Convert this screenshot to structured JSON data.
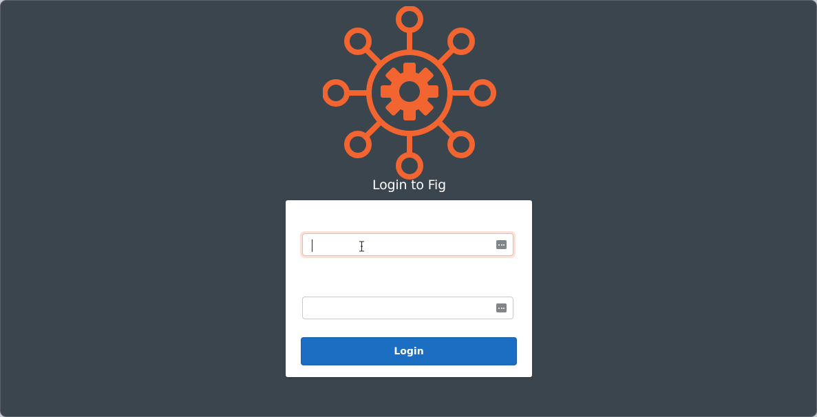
{
  "app": {
    "title": "Login to Fig"
  },
  "logo": {
    "icon": "fig-hub-gear-icon",
    "color": "#f26430"
  },
  "form": {
    "username": {
      "value": "",
      "placeholder": "",
      "focused": true,
      "autofill_icon": "keychain-autofill-icon"
    },
    "password": {
      "value": "",
      "placeholder": "",
      "autofill_icon": "keychain-autofill-icon"
    },
    "submit_label": "Login"
  },
  "colors": {
    "background": "#3b454d",
    "card": "#ffffff",
    "accent": "#1b6ec2",
    "focus_ring": "#fbe2d9"
  }
}
